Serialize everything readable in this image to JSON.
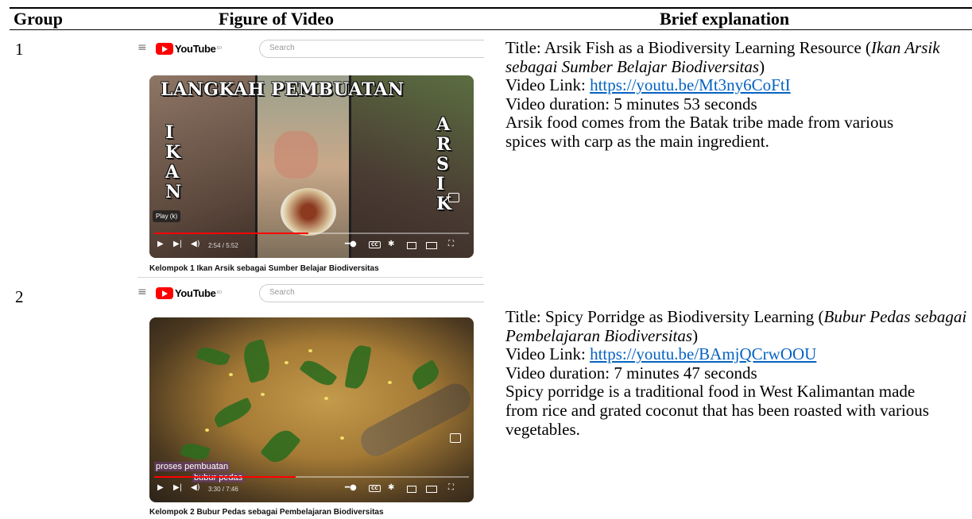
{
  "table": {
    "headers": {
      "group": "Group",
      "figure": "Figure of Video",
      "explanation": "Brief explanation"
    }
  },
  "youtube": {
    "logo_text": "YouTube",
    "search_placeholder": "Search"
  },
  "rows": [
    {
      "group": "1",
      "video": {
        "overlay_title": "LANGKAH PEMBUATAN",
        "overlay_left": "I K A N",
        "overlay_right": "A R S I K",
        "tooltip": "Play (k)",
        "time": "2:54 / 5:52",
        "progress": 0.49,
        "caption": "Kelompok 1 Ikan Arsik sebagai Sumber Belajar Biodiversitas"
      },
      "explanation": {
        "title_prefix": "Title: ",
        "title_en": "Arsik Fish as a Biodiversity Learning Resource",
        "title_id_open": "(",
        "title_id": "Ikan Arsik sebagai Sumber Belajar Biodiversitas",
        "title_id_close": ")",
        "link_label": "Video Link: ",
        "link": "https://youtu.be/Mt3ny6CoFtI",
        "duration": "Video duration: 5 minutes 53 seconds",
        "description": "Arsik food comes from the Batak tribe made from various spices with carp as the main ingredient."
      }
    },
    {
      "group": "2",
      "video": {
        "subtitle_line1": "proses pembuatan",
        "subtitle_line2": "bubur pedas",
        "time": "3:30 / 7:46",
        "progress": 0.45,
        "caption": "Kelompok 2 Bubur Pedas sebagai Pembelajaran Biodiversitas"
      },
      "explanation": {
        "title_prefix": "Title: ",
        "title_en": "Spicy Porridge as Biodiversity Learning",
        "title_id_open": "(",
        "title_id": "Bubur Pedas sebagai Pembelajaran Biodiversitas",
        "title_id_close": ")",
        "link_label": "Video Link: ",
        "link": "https://youtu.be/BAmjQCrwOOU",
        "duration": "Video duration: 7 minutes 47 seconds",
        "description": "Spicy porridge is a traditional food in West Kalimantan made from rice and grated coconut that has been roasted with various vegetables."
      }
    }
  ]
}
